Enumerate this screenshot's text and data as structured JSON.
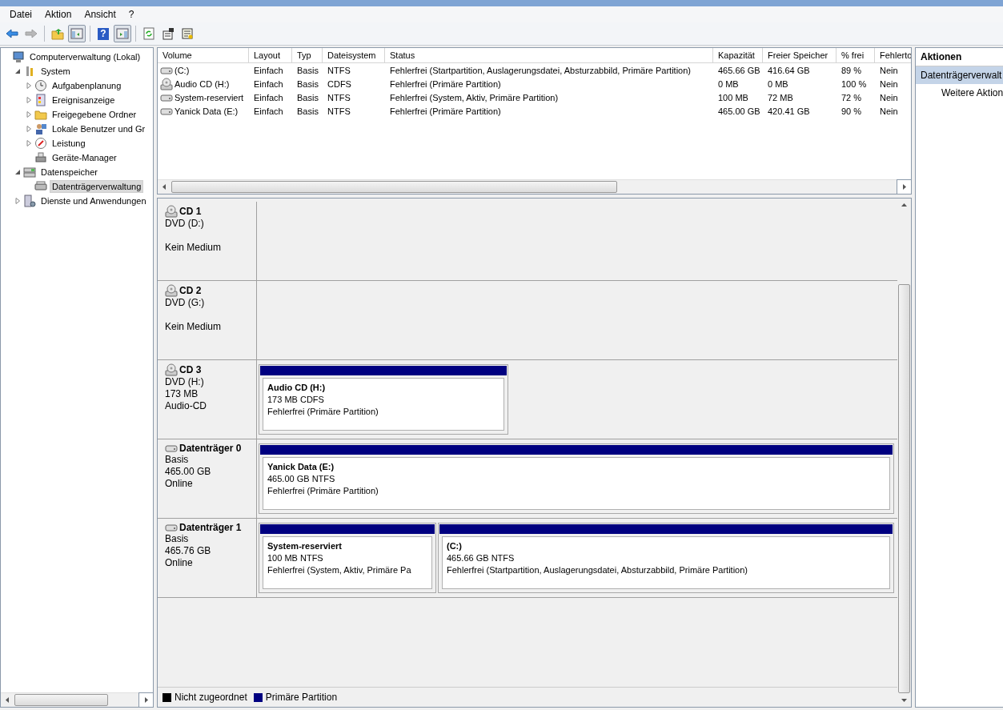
{
  "menu": [
    "Datei",
    "Aktion",
    "Ansicht",
    "?"
  ],
  "toolbar": [
    {
      "kind": "back",
      "disabled": false
    },
    {
      "kind": "forward",
      "disabled": true
    },
    {
      "kind": "sep"
    },
    {
      "kind": "up"
    },
    {
      "kind": "tree",
      "selected": true
    },
    {
      "kind": "sep"
    },
    {
      "kind": "help",
      "label": "?"
    },
    {
      "kind": "pane",
      "selected": true
    },
    {
      "kind": "sep"
    },
    {
      "kind": "refresh"
    },
    {
      "kind": "props"
    },
    {
      "kind": "settings"
    }
  ],
  "tree": [
    {
      "label": "Computerverwaltung (Lokal)",
      "kind": "computer",
      "selected": false,
      "children": [
        {
          "label": "System",
          "kind": "tools",
          "expanded": true,
          "selected": false,
          "children": [
            {
              "label": "Aufgabenplanung",
              "kind": "clock",
              "expanded": false,
              "selected": false
            },
            {
              "label": "Ereignisanzeige",
              "kind": "log",
              "expanded": false,
              "selected": false
            },
            {
              "label": "Freigegebene Ordner",
              "kind": "folder",
              "expanded": false,
              "selected": false
            },
            {
              "label": "Lokale Benutzer und Gr",
              "kind": "users",
              "expanded": false,
              "selected": false
            },
            {
              "label": "Leistung",
              "kind": "gauge",
              "expanded": false,
              "selected": false
            },
            {
              "label": "Geräte-Manager",
              "kind": "device",
              "selected": false
            }
          ]
        },
        {
          "label": "Datenspeicher",
          "kind": "storage",
          "expanded": true,
          "selected": false,
          "children": [
            {
              "label": "Datenträgerverwaltung",
              "kind": "disk",
              "selected": true
            }
          ]
        },
        {
          "label": "Dienste und Anwendungen",
          "kind": "services",
          "expanded": false,
          "selected": false
        }
      ]
    }
  ],
  "table": {
    "columns": [
      "Volume",
      "Layout",
      "Typ",
      "Dateisystem",
      "Status",
      "Kapazität",
      "Freier Speicher",
      "% frei",
      "Fehlerto"
    ],
    "rows": [
      {
        "kind": "disk",
        "cells": [
          "(C:)",
          "Einfach",
          "Basis",
          "NTFS",
          "Fehlerfrei (Startpartition, Auslagerungsdatei, Absturzabbild, Primäre Partition)",
          "465.66 GB",
          "416.64 GB",
          "89 %",
          "Nein"
        ]
      },
      {
        "kind": "cd",
        "cells": [
          "Audio CD (H:)",
          "Einfach",
          "Basis",
          "CDFS",
          "Fehlerfrei (Primäre Partition)",
          "0 MB",
          "0 MB",
          "100 %",
          "Nein"
        ]
      },
      {
        "kind": "disk",
        "cells": [
          "System-reserviert",
          "Einfach",
          "Basis",
          "NTFS",
          "Fehlerfrei (System, Aktiv, Primäre Partition)",
          "100 MB",
          "72 MB",
          "72 %",
          "Nein"
        ]
      },
      {
        "kind": "disk",
        "cells": [
          "Yanick Data (E:)",
          "Einfach",
          "Basis",
          "NTFS",
          "Fehlerfrei (Primäre Partition)",
          "465.00 GB",
          "420.41 GB",
          "90 %",
          "Nein"
        ]
      }
    ]
  },
  "disks": [
    {
      "kind": "cd",
      "name": "CD 1",
      "lines": [
        "DVD (D:)"
      ],
      "note": "Kein Medium"
    },
    {
      "kind": "cd",
      "name": "CD 2",
      "lines": [
        "DVD (G:)"
      ],
      "note": "Kein Medium"
    },
    {
      "kind": "cd",
      "name": "CD 3",
      "lines": [
        "DVD (H:)",
        "173 MB",
        "Audio-CD"
      ],
      "partitions": [
        {
          "name": "Audio CD  (H:)",
          "lines": [
            "173 MB CDFS",
            "Fehlerfrei (Primäre Partition)"
          ],
          "color": "#000080"
        }
      ]
    },
    {
      "kind": "disk",
      "name": "Datenträger 0",
      "lines": [
        "Basis",
        "465.00 GB",
        "Online"
      ],
      "partitions": [
        {
          "name": "Yanick Data  (E:)",
          "lines": [
            "465.00 GB NTFS",
            "Fehlerfrei (Primäre Partition)"
          ],
          "color": "#000080"
        }
      ]
    },
    {
      "kind": "disk",
      "name": "Datenträger 1",
      "lines": [
        "Basis",
        "465.76 GB",
        "Online"
      ],
      "partitions": [
        {
          "name": "System-reserviert",
          "lines": [
            "100 MB NTFS",
            "Fehlerfrei (System, Aktiv, Primäre Pa"
          ],
          "color": "#000080"
        },
        {
          "name": "(C:)",
          "lines": [
            "465.66 GB NTFS",
            "Fehlerfrei (Startpartition, Auslagerungsdatei, Absturzabbild, Primäre Partition)"
          ],
          "color": "#000080"
        }
      ]
    }
  ],
  "legend": [
    {
      "label": "Nicht zugeordnet",
      "color": "#000000"
    },
    {
      "label": "Primäre Partition",
      "color": "#000080"
    }
  ],
  "actions": {
    "title": "Aktionen",
    "items": [
      {
        "label": "Datenträgerverwalt",
        "kind": "header",
        "selected": true
      },
      {
        "label": "Weitere Aktion",
        "kind": "item",
        "selected": false
      }
    ]
  }
}
